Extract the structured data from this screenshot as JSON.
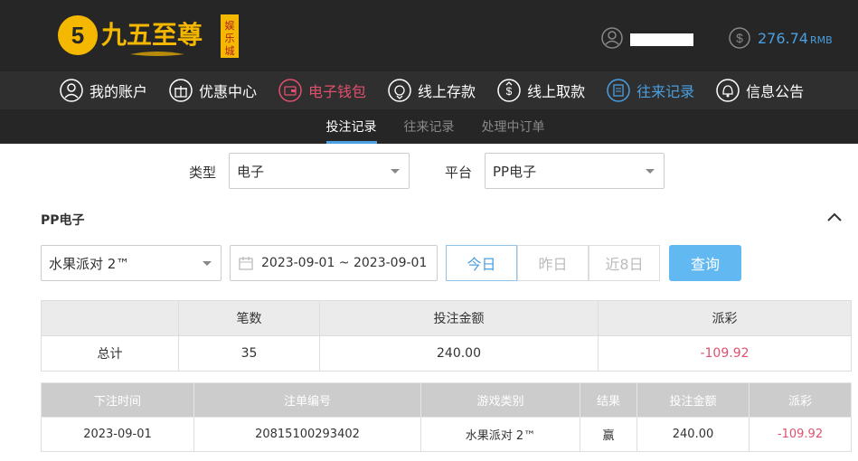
{
  "header": {
    "logo_text": "九五至尊",
    "logo_sub": "娱乐城",
    "balance_value": "276.74",
    "balance_unit": "RMB"
  },
  "nav": {
    "items": [
      {
        "label": "我的账户",
        "icon": "user-circle-icon",
        "color": "#ffffff"
      },
      {
        "label": "优惠中心",
        "icon": "gift-icon",
        "color": "#ffffff"
      },
      {
        "label": "电子钱包",
        "icon": "wallet-icon",
        "color": "#e0506e"
      },
      {
        "label": "线上存款",
        "icon": "deposit-icon",
        "color": "#ffffff"
      },
      {
        "label": "线上取款",
        "icon": "withdraw-icon",
        "color": "#ffffff"
      },
      {
        "label": "往来记录",
        "icon": "records-icon",
        "color": "#4a9fe0"
      },
      {
        "label": "信息公告",
        "icon": "bell-icon",
        "color": "#ffffff"
      }
    ]
  },
  "subtabs": [
    "投注记录",
    "往来记录",
    "处理中订单"
  ],
  "filters": {
    "type_label": "类型",
    "type_value": "电子",
    "platform_label": "平台",
    "platform_value": "PP电子"
  },
  "section": {
    "title": "PP电子",
    "game_value": "水果派对 2™",
    "date_range": "2023-09-01 ~ 2023-09-01",
    "quick": [
      "今日",
      "昨日",
      "近8日"
    ],
    "query_label": "查询"
  },
  "summary": {
    "headers": [
      "",
      "笔数",
      "投注金额",
      "派彩"
    ],
    "row": [
      "总计",
      "35",
      "240.00",
      "-109.92"
    ]
  },
  "details": {
    "headers": [
      "下注时间",
      "注单编号",
      "游戏类别",
      "结果",
      "投注金额",
      "派彩"
    ],
    "rows": [
      [
        "2023-09-01",
        "20815100293402",
        "水果派对 2™",
        "赢",
        "240.00",
        "-109.92"
      ]
    ]
  },
  "colors": {
    "accent_blue": "#4a9fe0",
    "accent_red": "#e0506e",
    "logo_gold": "#f5b800"
  }
}
